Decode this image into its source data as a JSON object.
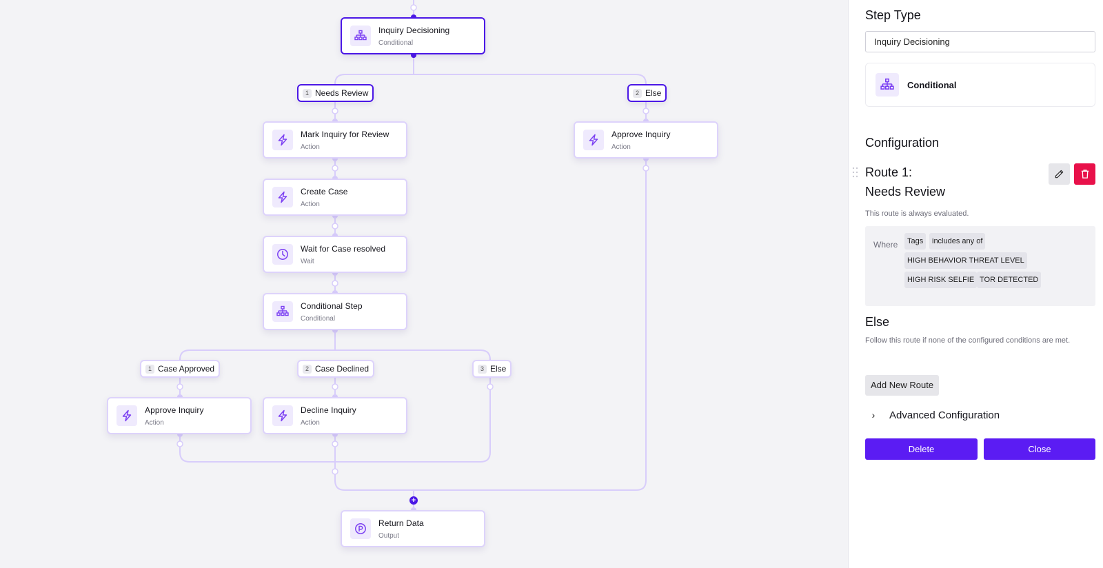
{
  "canvas": {
    "colors": {
      "accent": "#4b17e6",
      "edge": "#d8cdfb",
      "icon": "#7b3ff2",
      "icon_bg": "#efeafd"
    },
    "nodes": [
      {
        "id": "inquiry-decisioning",
        "title": "Inquiry Decisioning",
        "subtitle": "Conditional",
        "icon": "conditional-icon",
        "selected": true
      },
      {
        "id": "mark-inquiry-for-review",
        "title": "Mark Inquiry for Review",
        "subtitle": "Action",
        "icon": "lightning-icon"
      },
      {
        "id": "create-case",
        "title": "Create Case",
        "subtitle": "Action",
        "icon": "lightning-icon"
      },
      {
        "id": "wait-for-case-resolved",
        "title": "Wait for Case resolved",
        "subtitle": "Wait",
        "icon": "clock-icon"
      },
      {
        "id": "conditional-step",
        "title": "Conditional Step",
        "subtitle": "Conditional",
        "icon": "conditional-icon"
      },
      {
        "id": "approve-inquiry-1",
        "title": "Approve Inquiry",
        "subtitle": "Action",
        "icon": "lightning-icon"
      },
      {
        "id": "decline-inquiry",
        "title": "Decline Inquiry",
        "subtitle": "Action",
        "icon": "lightning-icon"
      },
      {
        "id": "approve-inquiry-2",
        "title": "Approve Inquiry",
        "subtitle": "Action",
        "icon": "lightning-icon"
      },
      {
        "id": "return-data",
        "title": "Return Data",
        "subtitle": "Output",
        "icon": "output-icon"
      }
    ],
    "branches": [
      {
        "id": "needs-review",
        "num": "1",
        "label": "Needs Review",
        "selected": true
      },
      {
        "id": "else-top",
        "num": "2",
        "label": "Else",
        "selected": true
      },
      {
        "id": "case-approved",
        "num": "1",
        "label": "Case Approved"
      },
      {
        "id": "case-declined",
        "num": "2",
        "label": "Case Declined"
      },
      {
        "id": "else-inner",
        "num": "3",
        "label": "Else"
      }
    ],
    "add_step_symbol": "+"
  },
  "panel": {
    "step_type_heading": "Step Type",
    "step_name_value": "Inquiry Decisioning",
    "type_card_label": "Conditional",
    "configuration_heading": "Configuration",
    "route": {
      "title_line1": "Route 1:",
      "title_line2": "Needs Review",
      "description": "This route is always evaluated.",
      "where_label": "Where",
      "field": "Tags",
      "operator": "includes any of",
      "values": [
        "HIGH BEHAVIOR THREAT LEVEL",
        "HIGH RISK SELFIE",
        "TOR DETECTED"
      ]
    },
    "else": {
      "heading": "Else",
      "description": "Follow this route if none of the configured conditions are met."
    },
    "add_route_label": "Add New Route",
    "advanced_label": "Advanced Configuration",
    "delete_label": "Delete",
    "close_label": "Close",
    "colors": {
      "primary": "#5b1cf3",
      "danger": "#e8114a"
    }
  }
}
